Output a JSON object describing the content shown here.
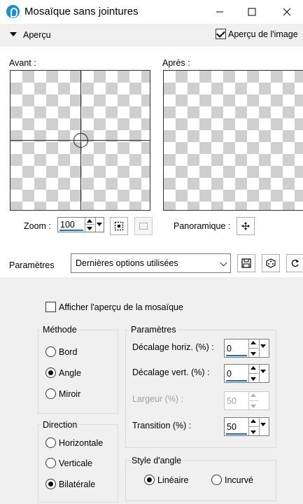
{
  "window": {
    "title": "Mosaïque sans jointures",
    "minimize_icon": "minimize-icon",
    "maximize_icon": "maximize-icon",
    "close_icon": "close-icon"
  },
  "preview": {
    "section_label": "Aperçu",
    "preview_image_label": "Aperçu de l'image",
    "preview_image_checked": true,
    "before_label": "Avant :",
    "after_label": "Après :",
    "zoom_label": "Zoom :",
    "zoom_value": "100",
    "pan_label": "Panoramique :"
  },
  "presets": {
    "label": "Paramètres",
    "selected": "Dernières options utilisées"
  },
  "options": {
    "show_tile_preview_label": "Afficher l'aperçu de la mosaïque",
    "show_tile_preview_checked": false
  },
  "method": {
    "title": "Méthode",
    "options": [
      "Bord",
      "Angle",
      "Miroir"
    ],
    "selected": "Angle"
  },
  "direction": {
    "title": "Direction",
    "options": [
      "Horizontale",
      "Verticale",
      "Bilatérale"
    ],
    "selected": "Bilatérale"
  },
  "parameters": {
    "title": "Paramètres",
    "horiz_offset_label": "Décalage horiz. (%) :",
    "horiz_offset_value": "0",
    "vert_offset_label": "Décalage vert. (%) :",
    "vert_offset_value": "0",
    "width_label": "Largeur (%) :",
    "width_value": "50",
    "transition_label": "Transition (%) :",
    "transition_value": "50"
  },
  "corner_style": {
    "title": "Style d'angle",
    "options": [
      "Linéaire",
      "Incurvé"
    ],
    "selected": "Linéaire"
  }
}
